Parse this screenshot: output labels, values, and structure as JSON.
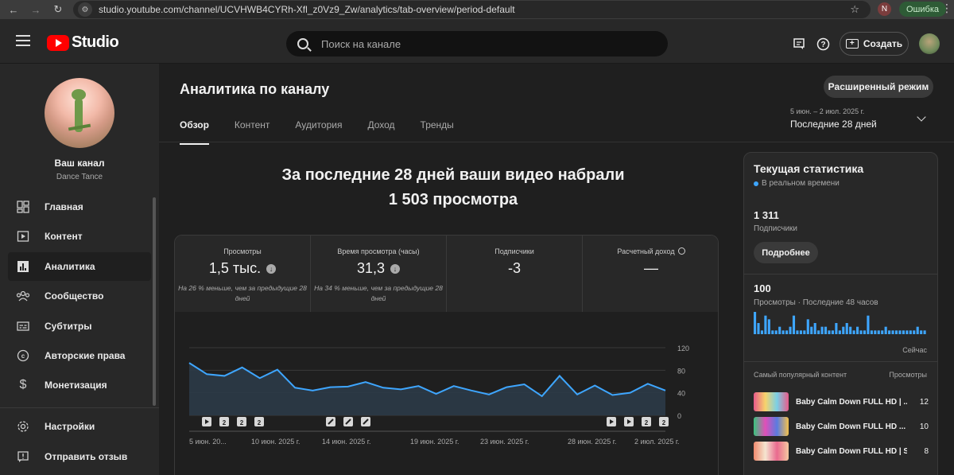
{
  "browser": {
    "url_host": "studio.youtube.com",
    "url_path": "/channel/UCVHWB4CYRh-Xfl_z0Vz9_Zw/analytics/tab-overview/period-default",
    "profile_letter": "N",
    "error_label": "Ошибка"
  },
  "header": {
    "logo_text": "Studio",
    "search_placeholder": "Поиск на канале",
    "create_label": "Создать"
  },
  "channel": {
    "title": "Ваш канал",
    "subtitle": "Dance Tance"
  },
  "sidebar": {
    "items": [
      {
        "label": "Главная",
        "icon": "dashboard-icon"
      },
      {
        "label": "Контент",
        "icon": "content-icon"
      },
      {
        "label": "Аналитика",
        "icon": "analytics-icon"
      },
      {
        "label": "Сообщество",
        "icon": "community-icon"
      },
      {
        "label": "Субтитры",
        "icon": "subtitles-icon"
      },
      {
        "label": "Авторские права",
        "icon": "copyright-icon"
      },
      {
        "label": "Монетизация",
        "icon": "monetization-icon"
      }
    ],
    "bottom": [
      {
        "label": "Настройки",
        "icon": "settings-icon"
      },
      {
        "label": "Отправить отзыв",
        "icon": "feedback-icon"
      }
    ]
  },
  "main": {
    "title": "Аналитика по каналу",
    "advanced_mode": "Расширенный режим",
    "tabs": [
      "Обзор",
      "Контент",
      "Аудитория",
      "Доход",
      "Тренды"
    ],
    "date_range": "5 июн. – 2 июл. 2025 г.",
    "date_label": "Последние 28 дней",
    "headline_line1": "За последние 28 дней ваши видео набрали",
    "headline_line2": "1 503 просмотра"
  },
  "metrics": [
    {
      "label": "Просмотры",
      "value": "1,5 тыс.",
      "note": "На 26 % меньше, чем за предыдущие 28 дней"
    },
    {
      "label": "Время просмотра (часы)",
      "value": "31,3",
      "note": "На 34 % меньше, чем за предыдущие 28 дней"
    },
    {
      "label": "Подписчики",
      "value": "-3",
      "note": ""
    },
    {
      "label": "Расчетный доход",
      "value": "—",
      "note": ""
    }
  ],
  "chart_data": {
    "type": "area",
    "title": "",
    "xlabel": "",
    "ylabel": "",
    "ylim": [
      0,
      120
    ],
    "y_ticks": [
      0,
      40,
      80,
      120
    ],
    "x_tick_labels": [
      "5 июн. 20...",
      "10 июн. 2025 г.",
      "14 июн. 2025 г.",
      "19 июн. 2025 г.",
      "23 июн. 2025 г.",
      "28 июн. 2025 г.",
      "2 июл. 2025 г."
    ],
    "series": [
      {
        "values": [
          93,
          73,
          70,
          85,
          66,
          81,
          49,
          44,
          50,
          51,
          59,
          49,
          46,
          52,
          38,
          52,
          44,
          37,
          50,
          55,
          34,
          70,
          37,
          53,
          36,
          40,
          56,
          44
        ],
        "color": "#3ea6ff"
      }
    ],
    "grid": true
  },
  "realtime": {
    "title": "Текущая статистика",
    "live_label": "В реальном времени",
    "subscribers": "1 311",
    "subscribers_label": "Подписчики",
    "more_button": "Подробнее",
    "views": "100",
    "views_label": "Просмотры · Последние 48 часов",
    "now_label": "Сейчас",
    "hourly_views": [
      6,
      3,
      1,
      5,
      4,
      1,
      1,
      2,
      1,
      1,
      2,
      5,
      1,
      1,
      1,
      4,
      2,
      3,
      1,
      2,
      2,
      1,
      1,
      3,
      1,
      2,
      3,
      2,
      1,
      2,
      1,
      1,
      5,
      1,
      1,
      1,
      1,
      2,
      1,
      1,
      1,
      1,
      1,
      1,
      1,
      1,
      2,
      1,
      1
    ],
    "top_header": "Самый популярный контент",
    "top_header_views": "Просмотры",
    "top_videos": [
      {
        "title": "Baby Calm Down FULL HD | ...",
        "views": "12"
      },
      {
        "title": "Baby Calm Down FULL HD ...",
        "views": "10"
      },
      {
        "title": "Baby Calm Down FULL HD | S...",
        "views": "8"
      }
    ]
  }
}
